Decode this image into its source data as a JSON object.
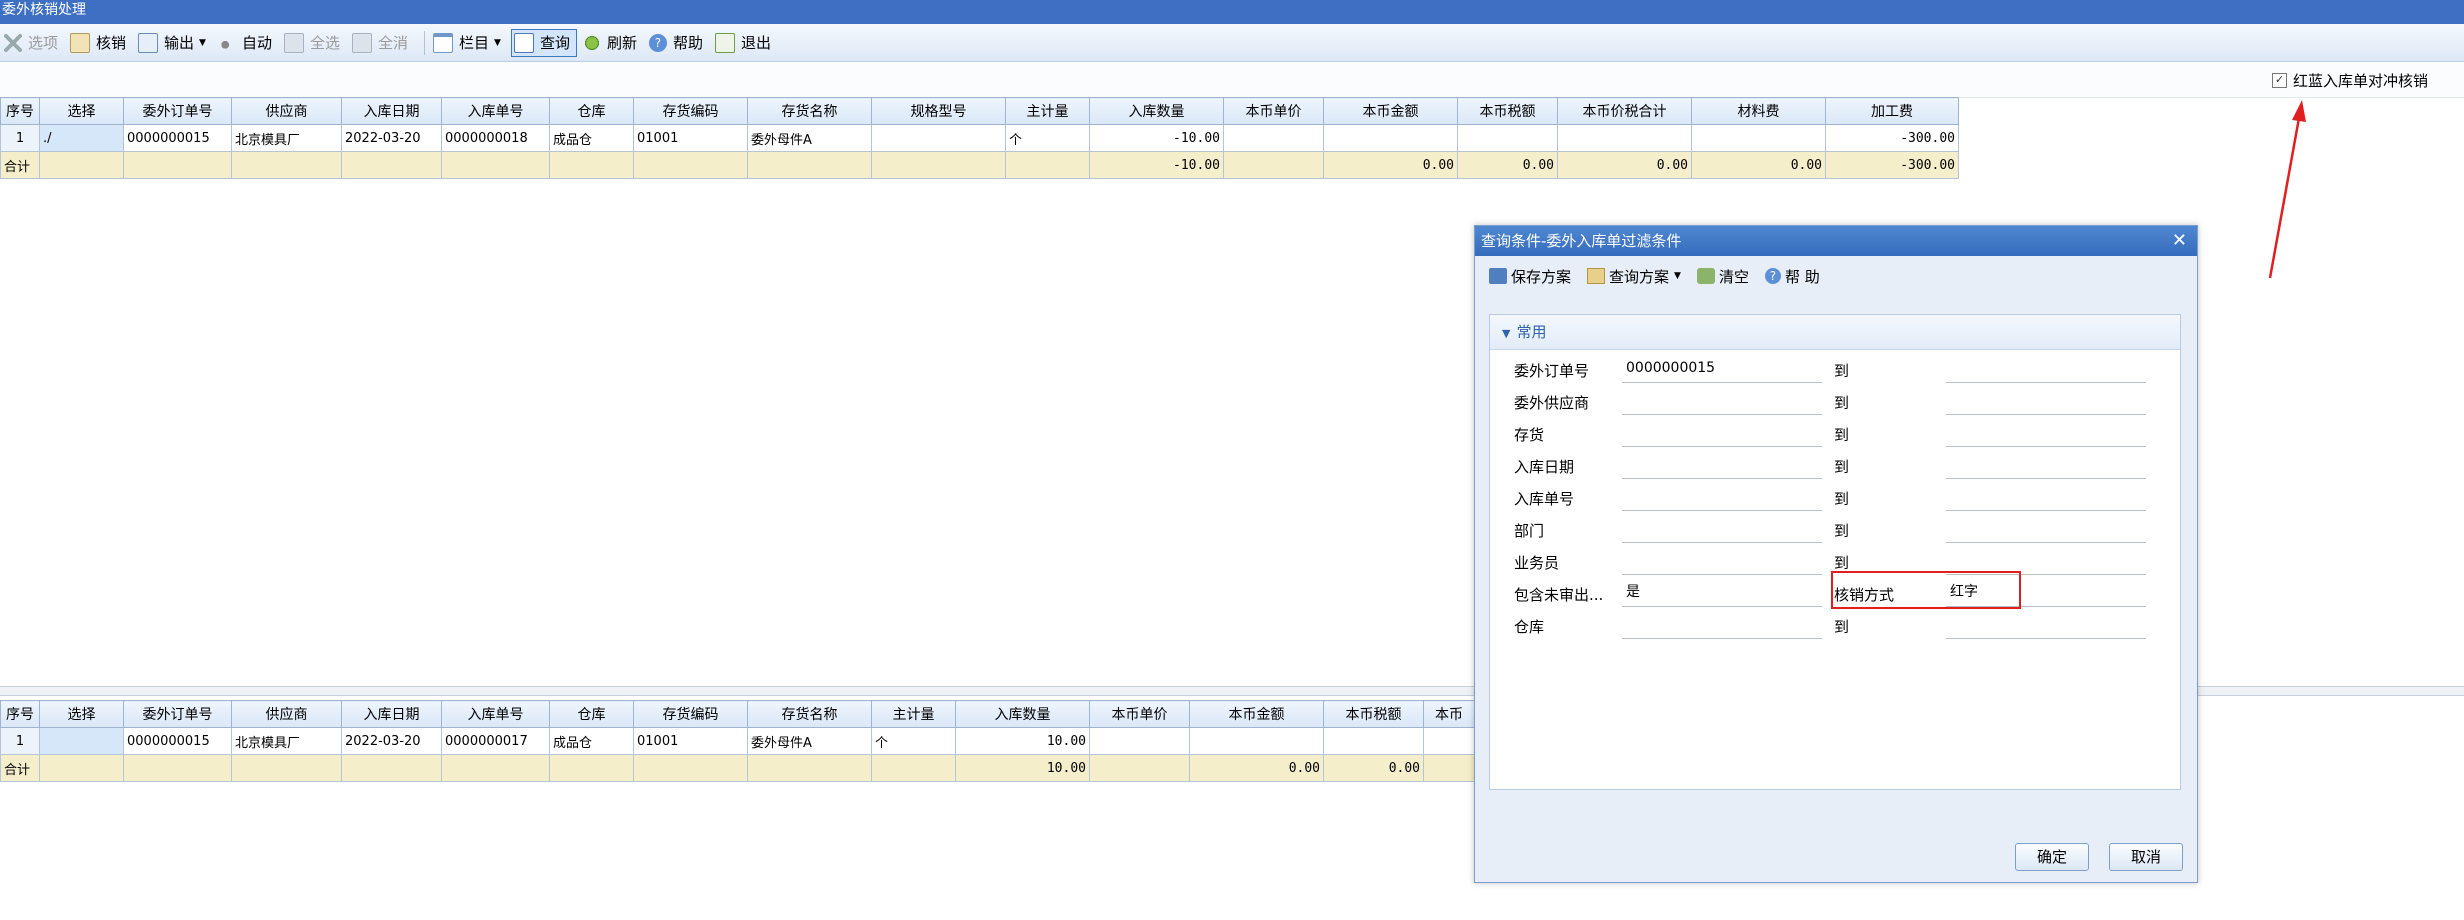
{
  "window": {
    "title": "委外核销处理"
  },
  "toolbar": {
    "items": [
      {
        "label": "选项",
        "icon": "options-icon",
        "disabled": true
      },
      {
        "label": "核销",
        "icon": "verify-icon",
        "disabled": false
      },
      {
        "label": "输出",
        "icon": "export-icon",
        "disabled": false
      },
      {
        "label": "自动",
        "icon": "auto-icon",
        "disabled": false
      },
      {
        "label": "全选",
        "icon": "select-all-icon",
        "disabled": true
      },
      {
        "label": "全消",
        "icon": "deselect-all-icon",
        "disabled": true
      },
      {
        "label": "栏目",
        "icon": "columns-icon",
        "disabled": false
      },
      {
        "label": "查询",
        "icon": "query-icon",
        "disabled": false
      },
      {
        "label": "刷新",
        "icon": "refresh-icon",
        "disabled": false
      },
      {
        "label": "帮助",
        "icon": "help-icon",
        "disabled": false
      },
      {
        "label": "退出",
        "icon": "exit-icon",
        "disabled": false
      }
    ]
  },
  "options": {
    "red_blue_label": "红蓝入库单对冲核销",
    "red_blue_checked": true
  },
  "top_grid": {
    "headers": [
      "序号",
      "选择",
      "委外订单号",
      "供应商",
      "入库日期",
      "入库单号",
      "仓库",
      "存货编码",
      "存货名称",
      "规格型号",
      "主计量",
      "入库数量",
      "本币单价",
      "本币金额",
      "本币税额",
      "本币价税合计",
      "材料费",
      "加工费"
    ],
    "rows": [
      [
        "1",
        "./",
        "0000000015",
        "北京模具厂",
        "2022-03-20",
        "0000000018",
        "成品仓",
        "01001",
        "委外母件A",
        "",
        "个",
        "-10.00",
        "",
        "",
        "",
        "",
        "",
        "-300.00"
      ]
    ],
    "total": [
      "合计",
      "",
      "",
      "",
      "",
      "",
      "",
      "",
      "",
      "",
      "",
      "-10.00",
      "",
      "0.00",
      "0.00",
      "0.00",
      "0.00",
      "-300.00"
    ]
  },
  "bottom_grid": {
    "headers": [
      "序号",
      "选择",
      "委外订单号",
      "供应商",
      "入库日期",
      "入库单号",
      "仓库",
      "存货编码",
      "存货名称",
      "主计量",
      "入库数量",
      "本币单价",
      "本币金额",
      "本币税额",
      "本币"
    ],
    "rows": [
      [
        "1",
        "",
        "0000000015",
        "北京模具厂",
        "2022-03-20",
        "0000000017",
        "成品仓",
        "01001",
        "委外母件A",
        "个",
        "10.00",
        "",
        "",
        "",
        ""
      ]
    ],
    "total": [
      "合计",
      "",
      "",
      "",
      "",
      "",
      "",
      "",
      "",
      "",
      "10.00",
      "",
      "0.00",
      "0.00",
      ""
    ]
  },
  "dialog": {
    "title": "查询条件-委外入库单过滤条件",
    "close_glyph": "✕",
    "tools": [
      {
        "label": "保存方案",
        "icon": "save-scheme-icon"
      },
      {
        "label": "查询方案",
        "icon": "query-scheme-icon"
      },
      {
        "label": "清空",
        "icon": "clear-icon"
      },
      {
        "label": "帮 助",
        "icon": "help-icon"
      }
    ],
    "section_title": "常用",
    "fields": [
      {
        "label": "委外订单号",
        "value1": "0000000015",
        "to": "到",
        "value2": ""
      },
      {
        "label": "委外供应商",
        "value1": "",
        "to": "到",
        "value2": ""
      },
      {
        "label": "存货",
        "value1": "",
        "to": "到",
        "value2": ""
      },
      {
        "label": "入库日期",
        "value1": "",
        "to": "到",
        "value2": ""
      },
      {
        "label": "入库单号",
        "value1": "",
        "to": "到",
        "value2": ""
      },
      {
        "label": "部门",
        "value1": "",
        "to": "到",
        "value2": ""
      },
      {
        "label": "业务员",
        "value1": "",
        "to": "到",
        "value2": ""
      },
      {
        "label": "包含未审出...",
        "value1": "是",
        "to": "核销方式",
        "value2": "红字"
      },
      {
        "label": "仓库",
        "value1": "",
        "to": "到",
        "value2": ""
      }
    ],
    "ok_label": "确定",
    "cancel_label": "取消"
  },
  "colors": {
    "title_bar": "#3d6fc2",
    "highlight_box": "#e02020",
    "annotation_arrow": "#e02020",
    "total_row": "#f5eecb"
  }
}
